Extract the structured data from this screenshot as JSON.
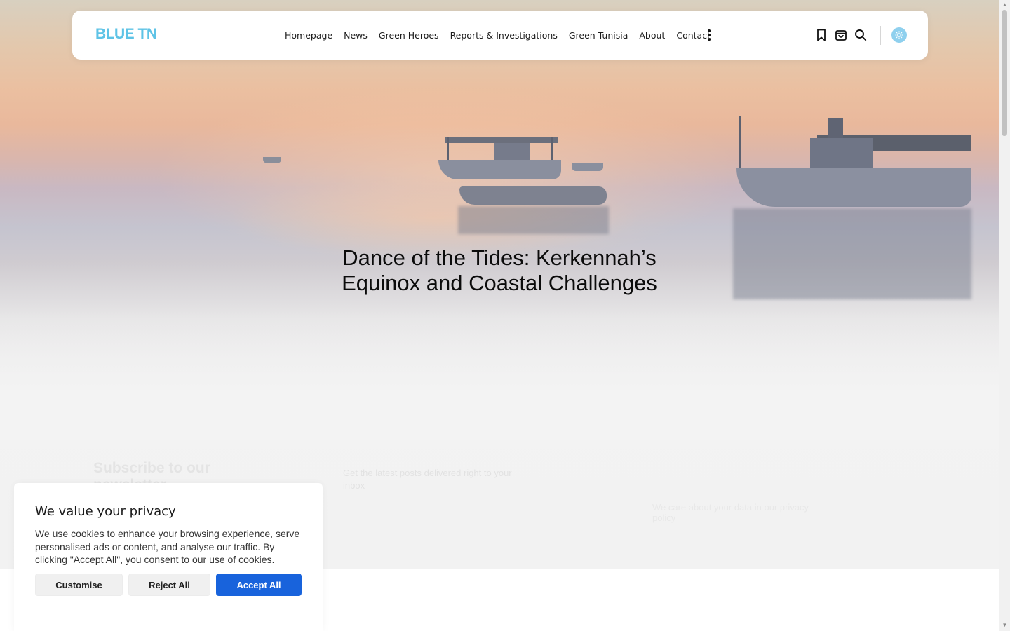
{
  "brand": {
    "logo_text": "BLUE TN",
    "logo_color": "#5ec3e6"
  },
  "nav": {
    "links": [
      "Homepage",
      "News",
      "Green Heroes",
      "Reports & Investigations",
      "Green Tunisia",
      "About",
      "Contact"
    ],
    "icons": [
      "more-vertical-icon",
      "bookmark-icon",
      "shopping-bag-icon",
      "search-icon",
      "sun-icon"
    ]
  },
  "hero": {
    "title_line1": "Dance of the Tides: Kerkennah’s",
    "title_line2": "Equinox and Coastal Challenges"
  },
  "subscribe": {
    "title_line1": "Subscribe to our",
    "title_line2": "newsletter",
    "description": "Get the latest posts delivered right to your inbox",
    "form_hint": "We care about your data in our privacy policy"
  },
  "cookie": {
    "title": "We value your privacy",
    "text": "We use cookies to enhance your browsing experience, serve personalised ads or content, and analyse our traffic. By clicking \"Accept All\", you consent to our use of cookies.",
    "buttons": {
      "customise": "Customise",
      "reject": "Reject All",
      "accept": "Accept All"
    },
    "accent_color": "#1863dc"
  }
}
